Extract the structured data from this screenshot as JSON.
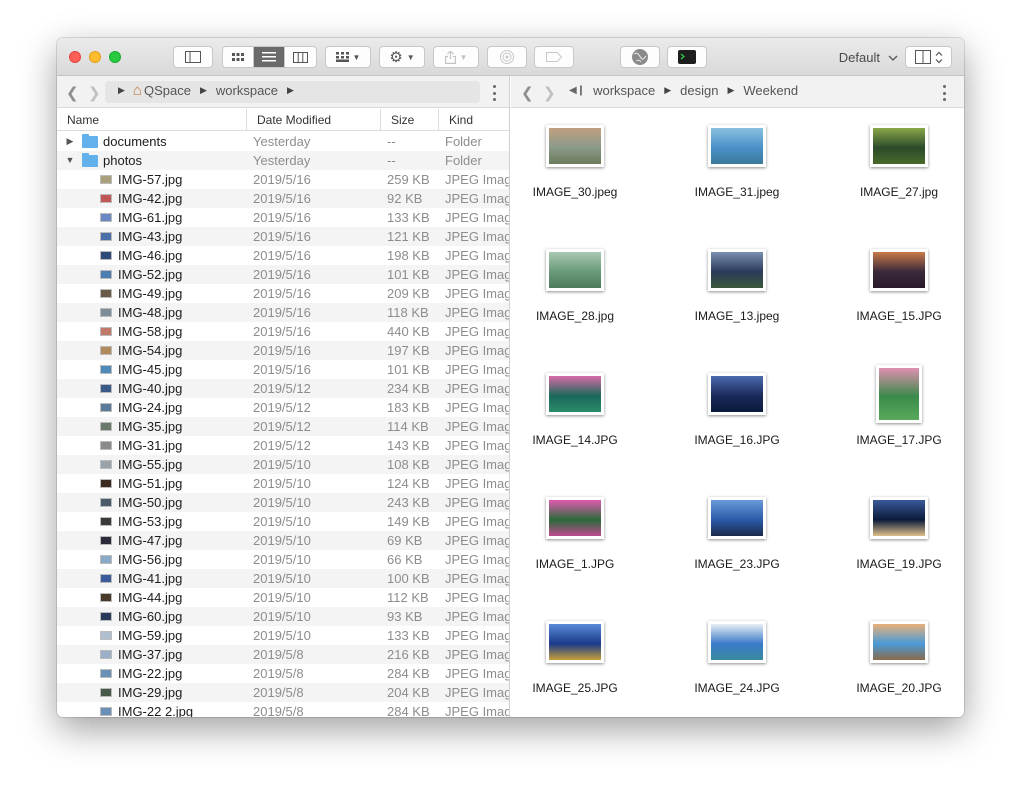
{
  "toolbar": {
    "preset": "Default",
    "colors": {
      "close": "#ff5f57",
      "minimize": "#febc2e",
      "zoom": "#28c840"
    }
  },
  "left_pane": {
    "path": [
      "QSpace",
      "workspace"
    ],
    "columns": [
      "Name",
      "Date Modified",
      "Size",
      "Kind"
    ],
    "rows": [
      {
        "name": "documents",
        "date": "Yesterday",
        "size": "--",
        "kind": "Folder",
        "type": "folder",
        "expanded": false
      },
      {
        "name": "photos",
        "date": "Yesterday",
        "size": "--",
        "kind": "Folder",
        "type": "folder",
        "expanded": true
      },
      {
        "name": "IMG-57.jpg",
        "date": "2019/5/16",
        "size": "259 KB",
        "kind": "JPEG Image",
        "type": "file",
        "color": "#a9a07e"
      },
      {
        "name": "IMG-42.jpg",
        "date": "2019/5/16",
        "size": "92 KB",
        "kind": "JPEG Image",
        "type": "file",
        "color": "#c25656"
      },
      {
        "name": "IMG-61.jpg",
        "date": "2019/5/16",
        "size": "133 KB",
        "kind": "JPEG Image",
        "type": "file",
        "color": "#6b88c2"
      },
      {
        "name": "IMG-43.jpg",
        "date": "2019/5/16",
        "size": "121 KB",
        "kind": "JPEG Image",
        "type": "file",
        "color": "#4a6fa8"
      },
      {
        "name": "IMG-46.jpg",
        "date": "2019/5/16",
        "size": "198 KB",
        "kind": "JPEG Image",
        "type": "file",
        "color": "#2e4a7a"
      },
      {
        "name": "IMG-52.jpg",
        "date": "2019/5/16",
        "size": "101 KB",
        "kind": "JPEG Image",
        "type": "file",
        "color": "#4c7fb0"
      },
      {
        "name": "IMG-49.jpg",
        "date": "2019/5/16",
        "size": "209 KB",
        "kind": "JPEG Image",
        "type": "file",
        "color": "#6a5a48"
      },
      {
        "name": "IMG-48.jpg",
        "date": "2019/5/16",
        "size": "118 KB",
        "kind": "JPEG Image",
        "type": "file",
        "color": "#7c8c98"
      },
      {
        "name": "IMG-58.jpg",
        "date": "2019/5/16",
        "size": "440 KB",
        "kind": "JPEG Image",
        "type": "file",
        "color": "#c07a6a"
      },
      {
        "name": "IMG-54.jpg",
        "date": "2019/5/16",
        "size": "197 KB",
        "kind": "JPEG Image",
        "type": "file",
        "color": "#b08a5a"
      },
      {
        "name": "IMG-45.jpg",
        "date": "2019/5/16",
        "size": "101 KB",
        "kind": "JPEG Image",
        "type": "file",
        "color": "#4f8ab8"
      },
      {
        "name": "IMG-40.jpg",
        "date": "2019/5/12",
        "size": "234 KB",
        "kind": "JPEG Image",
        "type": "file",
        "color": "#3a5a88"
      },
      {
        "name": "IMG-24.jpg",
        "date": "2019/5/12",
        "size": "183 KB",
        "kind": "JPEG Image",
        "type": "file",
        "color": "#5a7a9a"
      },
      {
        "name": "IMG-35.jpg",
        "date": "2019/5/12",
        "size": "114 KB",
        "kind": "JPEG Image",
        "type": "file",
        "color": "#6a7a6a"
      },
      {
        "name": "IMG-31.jpg",
        "date": "2019/5/12",
        "size": "143 KB",
        "kind": "JPEG Image",
        "type": "file",
        "color": "#8a8a8a"
      },
      {
        "name": "IMG-55.jpg",
        "date": "2019/5/10",
        "size": "108 KB",
        "kind": "JPEG Image",
        "type": "file",
        "color": "#9aa2aa"
      },
      {
        "name": "IMG-51.jpg",
        "date": "2019/5/10",
        "size": "124 KB",
        "kind": "JPEG Image",
        "type": "file",
        "color": "#3a2a22"
      },
      {
        "name": "IMG-50.jpg",
        "date": "2019/5/10",
        "size": "243 KB",
        "kind": "JPEG Image",
        "type": "file",
        "color": "#4a5a6a"
      },
      {
        "name": "IMG-53.jpg",
        "date": "2019/5/10",
        "size": "149 KB",
        "kind": "JPEG Image",
        "type": "file",
        "color": "#3a3a3a"
      },
      {
        "name": "IMG-47.jpg",
        "date": "2019/5/10",
        "size": "69 KB",
        "kind": "JPEG Image",
        "type": "file",
        "color": "#2a2a3a"
      },
      {
        "name": "IMG-56.jpg",
        "date": "2019/5/10",
        "size": "66 KB",
        "kind": "JPEG Image",
        "type": "file",
        "color": "#8aaac8"
      },
      {
        "name": "IMG-41.jpg",
        "date": "2019/5/10",
        "size": "100 KB",
        "kind": "JPEG Image",
        "type": "file",
        "color": "#3a5a9a"
      },
      {
        "name": "IMG-44.jpg",
        "date": "2019/5/10",
        "size": "112 KB",
        "kind": "JPEG Image",
        "type": "file",
        "color": "#4a3a2a"
      },
      {
        "name": "IMG-60.jpg",
        "date": "2019/5/10",
        "size": "93 KB",
        "kind": "JPEG Image",
        "type": "file",
        "color": "#2a3a5a"
      },
      {
        "name": "IMG-59.jpg",
        "date": "2019/5/10",
        "size": "133 KB",
        "kind": "JPEG Image",
        "type": "file",
        "color": "#b0c0d0"
      },
      {
        "name": "IMG-37.jpg",
        "date": "2019/5/8",
        "size": "216 KB",
        "kind": "JPEG Image",
        "type": "file",
        "color": "#9ab0c8"
      },
      {
        "name": "IMG-22.jpg",
        "date": "2019/5/8",
        "size": "284 KB",
        "kind": "JPEG Image",
        "type": "file",
        "color": "#6a90b8"
      },
      {
        "name": "IMG-29.jpg",
        "date": "2019/5/8",
        "size": "204 KB",
        "kind": "JPEG Image",
        "type": "file",
        "color": "#4a5a4a"
      },
      {
        "name": "IMG-22 2.jpg",
        "date": "2019/5/8",
        "size": "284 KB",
        "kind": "JPEG Image",
        "type": "file",
        "color": "#6a90b8"
      }
    ]
  },
  "right_pane": {
    "path": [
      "workspace",
      "design",
      "Weekend"
    ],
    "items": [
      {
        "name": "IMAGE_30.jpeg",
        "orient": "land",
        "colors": [
          "#8a9a8a",
          "#c0a080",
          "#6a7a5a"
        ]
      },
      {
        "name": "IMAGE_31.jpeg",
        "orient": "land",
        "colors": [
          "#4a90c8",
          "#8ac0e0",
          "#3a7a9a"
        ]
      },
      {
        "name": "IMAGE_27.jpg",
        "orient": "land",
        "colors": [
          "#2a4a2a",
          "#8aa84a",
          "#4a6a2a"
        ]
      },
      {
        "name": "IMAGE_28.jpg",
        "orient": "land",
        "colors": [
          "#6a9a7a",
          "#a8c8b0",
          "#4a7a5a"
        ]
      },
      {
        "name": "IMAGE_13.jpeg",
        "orient": "land",
        "colors": [
          "#2a3a5a",
          "#7a90b0",
          "#3a5a3a"
        ]
      },
      {
        "name": "IMAGE_15.JPG",
        "orient": "land",
        "colors": [
          "#3a2a3a",
          "#c87a4a",
          "#2a1a2a"
        ]
      },
      {
        "name": "IMAGE_14.JPG",
        "orient": "land",
        "colors": [
          "#1a6a5a",
          "#d86aa8",
          "#2a8a6a"
        ]
      },
      {
        "name": "IMAGE_16.JPG",
        "orient": "land",
        "colors": [
          "#1a2a5a",
          "#4a6ab0",
          "#0a1a3a"
        ]
      },
      {
        "name": "IMAGE_17.JPG",
        "orient": "port",
        "colors": [
          "#3a8a4a",
          "#e090b0",
          "#5aaa5a"
        ]
      },
      {
        "name": "IMAGE_1.JPG",
        "orient": "land",
        "colors": [
          "#2a6a3a",
          "#e05ab0",
          "#c04a90"
        ]
      },
      {
        "name": "IMAGE_23.JPG",
        "orient": "land",
        "colors": [
          "#2a5aa8",
          "#6a9ad8",
          "#1a2a4a"
        ]
      },
      {
        "name": "IMAGE_19.JPG",
        "orient": "land",
        "colors": [
          "#0a1a3a",
          "#3a5a9a",
          "#e0c08a"
        ]
      },
      {
        "name": "IMAGE_25.JPG",
        "orient": "land",
        "colors": [
          "#1a3a8a",
          "#5a8ad8",
          "#c8a03a"
        ]
      },
      {
        "name": "IMAGE_24.JPG",
        "orient": "land",
        "colors": [
          "#3a7ac8",
          "#e8eef5",
          "#3a8aa0"
        ]
      },
      {
        "name": "IMAGE_20.JPG",
        "orient": "land",
        "colors": [
          "#4a9ad8",
          "#e8b07a",
          "#8a6a4a"
        ]
      }
    ]
  }
}
